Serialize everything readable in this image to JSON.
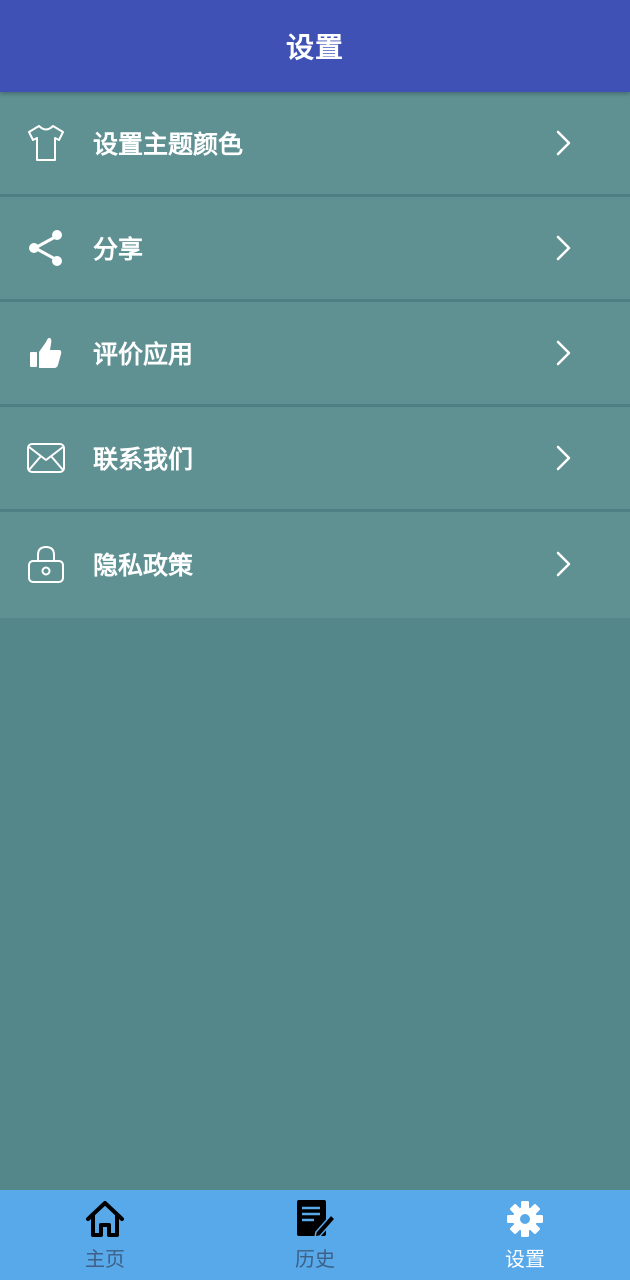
{
  "header": {
    "title": "设置"
  },
  "menu": {
    "items": [
      {
        "label": "设置主题颜色",
        "icon": "tshirt-icon"
      },
      {
        "label": "分享",
        "icon": "share-icon"
      },
      {
        "label": "评价应用",
        "icon": "thumbs-up-icon"
      },
      {
        "label": "联系我们",
        "icon": "envelope-icon"
      },
      {
        "label": "隐私政策",
        "icon": "lock-icon"
      }
    ]
  },
  "bottom_nav": {
    "items": [
      {
        "label": "主页",
        "icon": "home-icon",
        "active": false
      },
      {
        "label": "历史",
        "icon": "history-edit-icon",
        "active": false
      },
      {
        "label": "设置",
        "icon": "gear-icon",
        "active": true
      }
    ]
  },
  "colors": {
    "header_bg": "#3f51b5",
    "menu_bg": "#5f9193",
    "page_bg": "#538789",
    "bottom_nav_bg": "#58a9ea",
    "nav_inactive": "#3e5f86",
    "nav_active": "#ffffff"
  }
}
